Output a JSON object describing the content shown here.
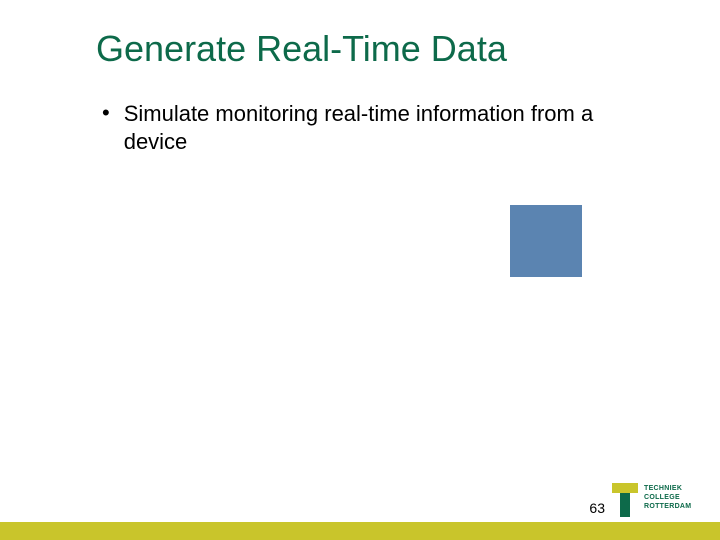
{
  "title": "Generate Real-Time Data",
  "bullet": "•",
  "bullet_text": "Simulate monitoring real-time information from a device",
  "page_number": "63",
  "logo": {
    "line1": "TECHNIEK",
    "line2": "COLLEGE",
    "line3": "ROTTERDAM"
  },
  "colors": {
    "title": "#0d6a4a",
    "blue_box": "#5b84b1",
    "footer": "#c9c52b"
  }
}
